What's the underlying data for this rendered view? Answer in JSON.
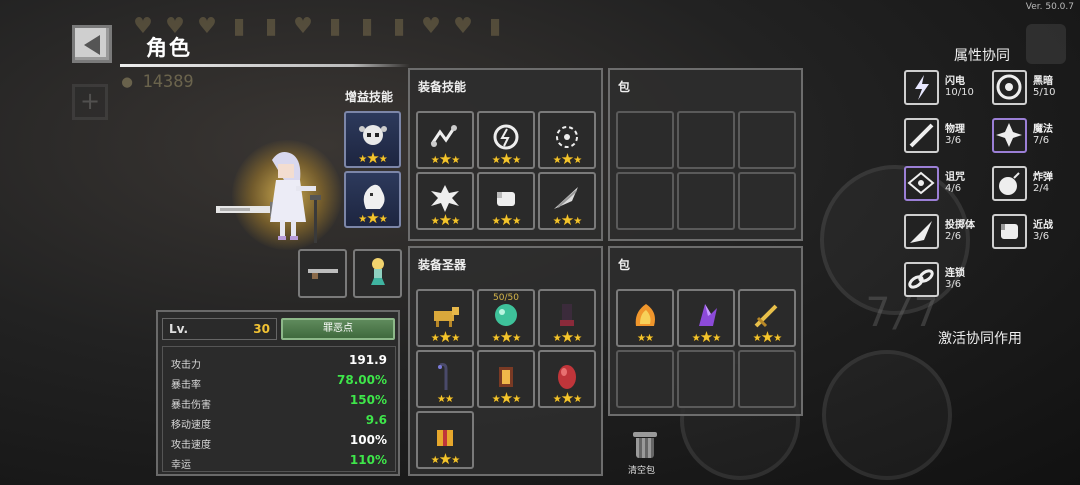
{
  "version": "Ver. 50.0.7",
  "header": {
    "title": "角色"
  },
  "background": {
    "gold": "14389",
    "fraction": "7/7"
  },
  "character": {
    "level_label": "Lv.",
    "level": "30",
    "sin_button": "罪恶点",
    "gain_skills_label": "增益技能",
    "gain_skills": [
      {
        "icon": "skull-burst-icon",
        "stars": 3
      },
      {
        "icon": "ghost-flame-icon",
        "stars": 3
      }
    ],
    "weapons": [
      {
        "icon": "rifle-icon"
      },
      {
        "icon": "mermaid-pet-icon"
      }
    ],
    "stats": [
      {
        "name": "攻击力",
        "value": "191.9",
        "color": "#ffffff"
      },
      {
        "name": "暴击率",
        "value": "78.00%",
        "color": "#3ee64a"
      },
      {
        "name": "暴击伤害",
        "value": "150%",
        "color": "#3ee64a"
      },
      {
        "name": "移动速度",
        "value": "9.6",
        "color": "#3ee64a"
      },
      {
        "name": "攻击速度",
        "value": "100%",
        "color": "#ffffff"
      },
      {
        "name": "幸运",
        "value": "110%",
        "color": "#3ee64a"
      }
    ]
  },
  "equip_skills": {
    "title": "装备技能",
    "items": [
      {
        "icon": "chain-lightning-icon",
        "stars": 3
      },
      {
        "icon": "storm-orb-icon",
        "stars": 3
      },
      {
        "icon": "spark-burst-icon",
        "stars": 3
      },
      {
        "icon": "explosion-icon",
        "stars": 3
      },
      {
        "icon": "fist-icon",
        "stars": 3
      },
      {
        "icon": "feather-blade-icon",
        "stars": 3
      }
    ]
  },
  "skill_bag": {
    "title": "包"
  },
  "equip_relics": {
    "title": "装备圣器",
    "items": [
      {
        "icon": "golden-bull-icon",
        "stars": 3,
        "top_text": ""
      },
      {
        "icon": "jade-spirit-icon",
        "stars": 3,
        "top_text": "50/50"
      },
      {
        "icon": "dark-gauntlet-icon",
        "stars": 3,
        "top_text": ""
      },
      {
        "icon": "crook-staff-icon",
        "stars": 2,
        "top_text": ""
      },
      {
        "icon": "lantern-icon",
        "stars": 3,
        "top_text": ""
      },
      {
        "icon": "red-egg-icon",
        "stars": 3,
        "top_text": ""
      },
      {
        "icon": "gift-box-icon",
        "stars": 3,
        "top_text": ""
      }
    ]
  },
  "relic_bag": {
    "title": "包",
    "items": [
      {
        "icon": "flame-shell-icon",
        "stars": 2
      },
      {
        "icon": "purple-crystal-icon",
        "stars": 3
      },
      {
        "icon": "golden-sword-icon",
        "stars": 3
      }
    ]
  },
  "clear_bag": {
    "label": "清空包"
  },
  "synergy": {
    "title": "属性协同",
    "activate_label": "激活协同作用",
    "items": [
      {
        "name": "闪电",
        "count": "10/10",
        "icon": "lightning-icon"
      },
      {
        "name": "黑暗",
        "count": "5/10",
        "icon": "dark-orb-icon"
      },
      {
        "name": "物理",
        "count": "3/6",
        "icon": "sword-slash-icon"
      },
      {
        "name": "魔法",
        "count": "7/6",
        "icon": "magic-star-icon"
      },
      {
        "name": "诅咒",
        "count": "4/6",
        "icon": "curse-eye-icon"
      },
      {
        "name": "炸弹",
        "count": "2/4",
        "icon": "bomb-icon"
      },
      {
        "name": "投掷体",
        "count": "2/6",
        "icon": "projectile-icon"
      },
      {
        "name": "近战",
        "count": "3/6",
        "icon": "melee-fist-icon"
      },
      {
        "name": "连锁",
        "count": "3/6",
        "icon": "chain-icon"
      }
    ]
  }
}
